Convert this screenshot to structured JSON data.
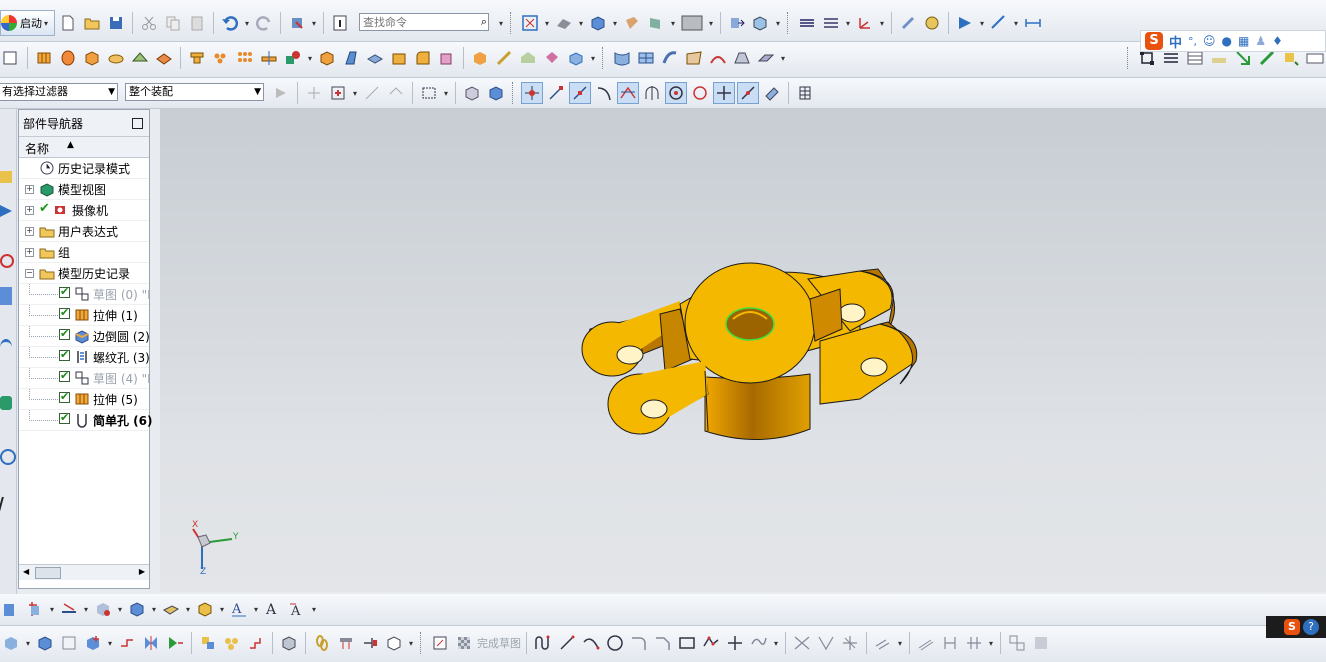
{
  "toolbar1": {
    "start_label": "启动",
    "search_placeholder": "查找命令"
  },
  "selection_bar": {
    "filter_value": "有选择过滤器",
    "scope_value": "整个装配"
  },
  "ime": {
    "logo": "S",
    "mode": "中",
    "punct": "°,"
  },
  "navigator": {
    "title": "部件导航器",
    "column_name": "名称",
    "items": [
      {
        "label": "历史记录模式"
      },
      {
        "label": "模型视图"
      },
      {
        "label": "摄像机"
      },
      {
        "label": "用户表达式"
      },
      {
        "label": "组"
      },
      {
        "label": "模型历史记录"
      }
    ],
    "features": [
      {
        "label": "草图 (0) \"I",
        "suppressed": true
      },
      {
        "label": "拉伸 (1)",
        "suppressed": false
      },
      {
        "label": "边倒圆 (2)",
        "suppressed": false
      },
      {
        "label": "螺纹孔 (3)",
        "suppressed": false
      },
      {
        "label": "草图 (4) \"I",
        "suppressed": true
      },
      {
        "label": "拉伸 (5)",
        "suppressed": false
      },
      {
        "label": "简单孔 (6)",
        "suppressed": false,
        "current": true
      }
    ]
  },
  "triad": {
    "x": "X",
    "y": "Y",
    "z": "Z"
  },
  "sketch_bar": {
    "finish_label": "完成草图"
  },
  "colors": {
    "part_face": "#f5b800",
    "part_shadow": "#a86a00",
    "accent_blue": "#2f6fbf"
  }
}
